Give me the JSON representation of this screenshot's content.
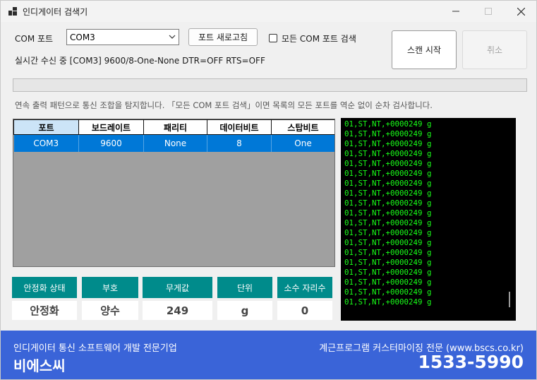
{
  "window": {
    "title": "인디게이터 검색기",
    "colors": {
      "accent": "#0078d7",
      "teal": "#008b8b",
      "footer": "#3a64d8",
      "log_text": "#18ff18"
    }
  },
  "controls": {
    "com_port_label": "COM 포트",
    "com_port_value": "COM3",
    "refresh_button": "포트 새로고침",
    "all_ports_checkbox": "모든 COM 포트 검색",
    "all_ports_checked": false,
    "scan_start_button": "스캔 시작",
    "cancel_button": "취소",
    "status_text": "실시간 수신 중 [COM3] 9600/8-One-None DTR=OFF RTS=OFF",
    "description": "연속 출력 패턴으로 통신 조합을 탐지합니다. 「모든 COM 포트 검색」이면 목록의 모든 포트를 역순 없이 순차 검사합니다."
  },
  "grid": {
    "headers": [
      "포트",
      "보드레이트",
      "패리티",
      "데이터비트",
      "스탑비트"
    ],
    "rows": [
      [
        "COM3",
        "9600",
        "None",
        "8",
        "One"
      ]
    ]
  },
  "log": {
    "lines": [
      "01,ST,NT,+0000249 g",
      "01,ST,NT,+0000249 g",
      "01,ST,NT,+0000249 g",
      "01,ST,NT,+0000249 g",
      "01,ST,NT,+0000249 g",
      "01,ST,NT,+0000249 g",
      "01,ST,NT,+0000249 g",
      "01,ST,NT,+0000249 g",
      "01,ST,NT,+0000249 g",
      "01,ST,NT,+0000249 g",
      "01,ST,NT,+0000249 g",
      "01,ST,NT,+0000249 g",
      "01,ST,NT,+0000249 g",
      "01,ST,NT,+0000249 g",
      "01,ST,NT,+0000249 g",
      "01,ST,NT,+0000249 g",
      "01,ST,NT,+0000249 g",
      "01,ST,NT,+0000249 g",
      "01,ST,NT,+0000249 g"
    ]
  },
  "stats": {
    "stability_label": "안정화 상태",
    "stability_value": "안정화",
    "sign_label": "부호",
    "sign_value": "양수",
    "weight_label": "무게값",
    "weight_value": "249",
    "unit_label": "단위",
    "unit_value": "g",
    "decimal_label": "소수 자리수",
    "decimal_value": "0"
  },
  "footer": {
    "left_line": "인디게이터 통신 소프트웨어 개발 전문기업",
    "company": "비에스씨",
    "right_line": "계근프로그램 커스터마이징 전문 (www.bscs.co.kr)",
    "phone": "1533-5990"
  }
}
